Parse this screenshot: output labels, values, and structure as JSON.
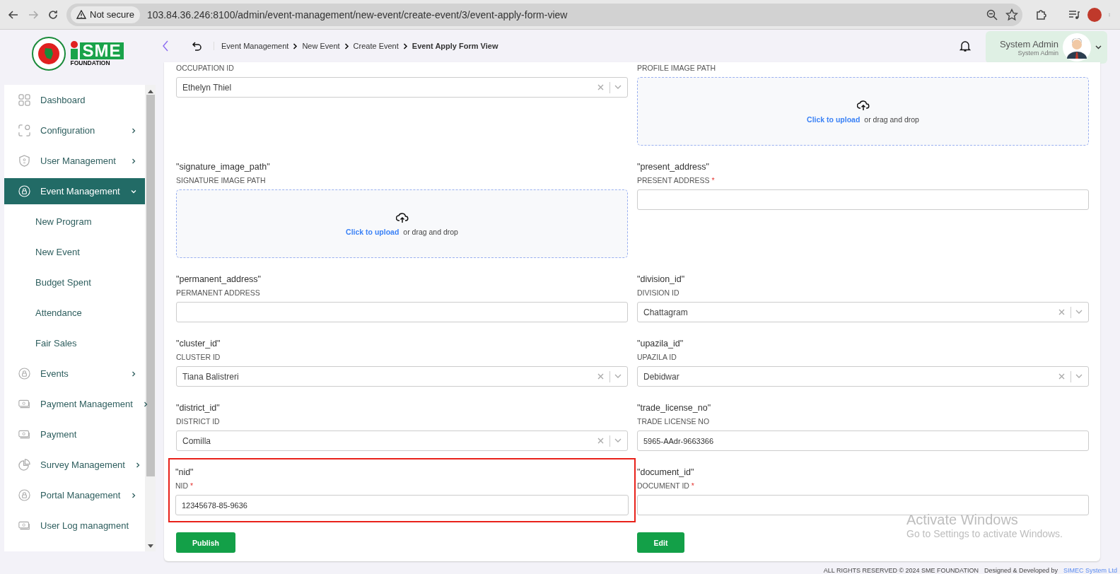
{
  "browser": {
    "security": "Not secure",
    "url": "103.84.36.246:8100/admin/event-management/new-event/create-event/3/event-apply-form-view"
  },
  "logo": {
    "name": "SME",
    "subtitle": "FOUNDATION"
  },
  "breadcrumb": [
    {
      "label": "Event Management",
      "current": false
    },
    {
      "label": "New Event",
      "current": false
    },
    {
      "label": "Create Event",
      "current": false
    },
    {
      "label": "Event Apply Form View",
      "current": true
    }
  ],
  "user": {
    "name": "System Admin",
    "role": "System Admin"
  },
  "sidebar": {
    "items": [
      {
        "label": "Dashboard",
        "has_submenu": false,
        "selected": false
      },
      {
        "label": "Configuration",
        "has_submenu": true,
        "selected": false
      },
      {
        "label": "User Management",
        "has_submenu": true,
        "selected": false
      },
      {
        "label": "Event Management",
        "has_submenu": true,
        "selected": true,
        "expanded": true,
        "children": [
          {
            "label": "New Program"
          },
          {
            "label": "New Event"
          },
          {
            "label": "Budget Spent"
          },
          {
            "label": "Attendance"
          },
          {
            "label": "Fair Sales"
          }
        ]
      },
      {
        "label": "Events",
        "has_submenu": true,
        "selected": false
      },
      {
        "label": "Payment Management",
        "has_submenu": true,
        "selected": false
      },
      {
        "label": "Payment",
        "has_submenu": false,
        "selected": false
      },
      {
        "label": "Survey Management",
        "has_submenu": true,
        "selected": false
      },
      {
        "label": "Portal Management",
        "has_submenu": true,
        "selected": false
      },
      {
        "label": "User Log managment",
        "has_submenu": false,
        "selected": false
      }
    ]
  },
  "form": {
    "fields": [
      {
        "kind": "select",
        "label": "OCCUPATION ID",
        "value": "Ethelyn Thiel",
        "highlighted": false
      },
      {
        "kind": "upload",
        "label": "PROFILE IMAGE PATH",
        "link": "Click to upload",
        "hint": "or drag and drop",
        "highlighted": false
      },
      {
        "kind": "upload",
        "key": "\"signature_image_path\"",
        "label": "SIGNATURE IMAGE PATH",
        "link": "Click to upload",
        "hint": "or drag and drop",
        "highlighted": false
      },
      {
        "kind": "text",
        "key": "\"present_address\"",
        "label": "PRESENT ADDRESS",
        "required_mark": "*",
        "highlighted": false
      },
      {
        "kind": "text",
        "key": "\"permanent_address\"",
        "label": "PERMANENT ADDRESS",
        "highlighted": false
      },
      {
        "kind": "select",
        "key": "\"division_id\"",
        "label": "DIVISION ID",
        "value": "Chattagram",
        "highlighted": false
      },
      {
        "kind": "select",
        "key": "\"cluster_id\"",
        "label": "CLUSTER ID",
        "value": "Tiana Balistreri",
        "highlighted": false
      },
      {
        "kind": "select",
        "key": "\"upazila_id\"",
        "label": "UPAZILA ID",
        "value": "Debidwar",
        "highlighted": false
      },
      {
        "kind": "select",
        "key": "\"district_id\"",
        "label": "DISTRICT ID",
        "value": "Comilla",
        "highlighted": false
      },
      {
        "kind": "text",
        "key": "\"trade_license_no\"",
        "label": "TRADE LICENSE NO",
        "value": "5965-AAdr-9663366",
        "highlighted": false
      },
      {
        "kind": "text",
        "key": "\"nid\"",
        "label": "NID",
        "required_mark": "*",
        "value": "12345678-85-9636",
        "highlighted": true
      },
      {
        "kind": "text",
        "key": "\"document_id\"",
        "label": "DOCUMENT ID",
        "required_mark": "*",
        "highlighted": false
      }
    ],
    "buttons": [
      "Publish",
      "Edit"
    ]
  },
  "os_notice": {
    "title": "Activate Windows",
    "text": "Go to Settings to activate Windows."
  },
  "footer": {
    "rights": "ALL RIGHTS RESERVED © 2024 SME FOUNDATION",
    "credit": "Designed & Developed by",
    "company": "SIMEC System Ltd"
  }
}
